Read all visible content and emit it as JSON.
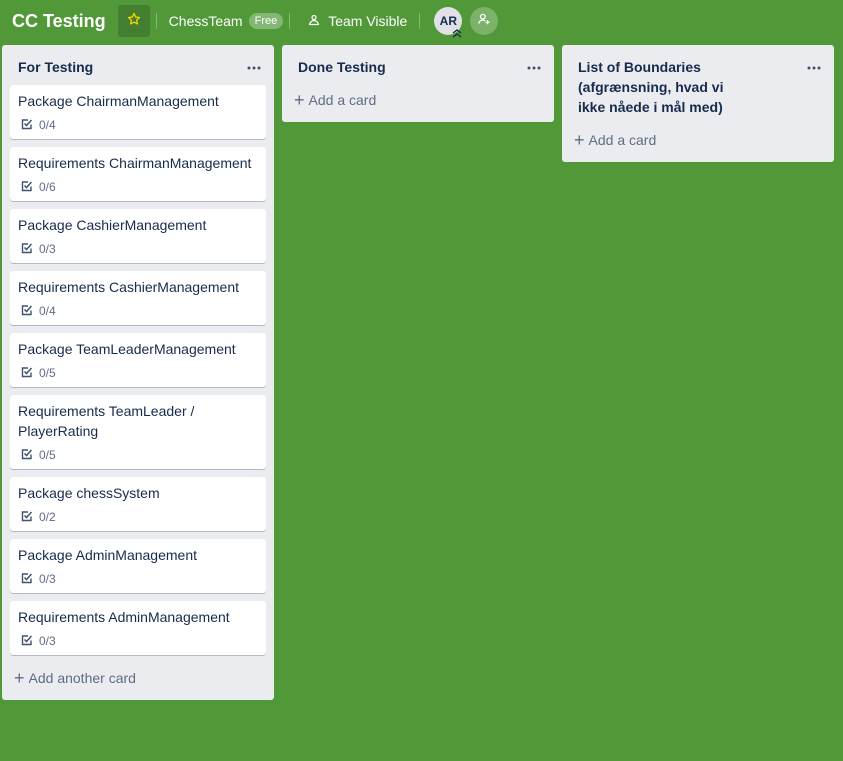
{
  "header": {
    "board_title": "CC Testing",
    "team_name": "ChessTeam",
    "plan_badge": "Free",
    "visibility": "Team Visible",
    "member_initials": "AR",
    "star_icon": "star-icon",
    "invite_icon": "add-member-icon"
  },
  "colors": {
    "board_background": "#519839",
    "list_background": "#ebecf0",
    "star_color": "#f2d600"
  },
  "lists": [
    {
      "title": "For Testing",
      "add_label": "Add another card",
      "cards": [
        {
          "title": "Package ChairmanManagement",
          "checklist": "0/4"
        },
        {
          "title": "Requirements ChairmanManagement",
          "checklist": "0/6"
        },
        {
          "title": "Package CashierManagement",
          "checklist": "0/3"
        },
        {
          "title": "Requirements CashierManagement",
          "checklist": "0/4"
        },
        {
          "title": "Package TeamLeaderManagement",
          "checklist": "0/5"
        },
        {
          "title": "Requirements TeamLeader / PlayerRating",
          "checklist": "0/5"
        },
        {
          "title": "Package chessSystem",
          "checklist": "0/2"
        },
        {
          "title": "Package AdminManagement",
          "checklist": "0/3"
        },
        {
          "title": "Requirements AdminManagement",
          "checklist": "0/3"
        }
      ]
    },
    {
      "title": "Done Testing",
      "add_label": "Add a card",
      "cards": []
    },
    {
      "title": "List of Boundaries (afgrænsning, hvad vi ikke nåede i mål med)",
      "add_label": "Add a card",
      "cards": []
    }
  ]
}
